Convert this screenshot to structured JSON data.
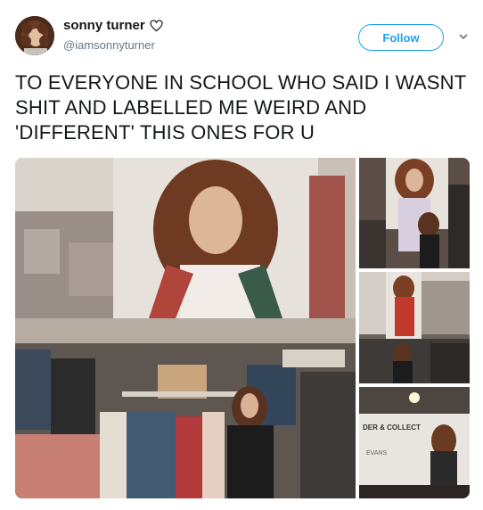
{
  "tweet": {
    "display_name": "sonny turner",
    "handle": "@iamsonnyturner",
    "follow_label": "Follow",
    "text": "TO EVERYONE IN SCHOOL WHO SAID I WASNT SHIT AND LABELLED ME WEIRD AND 'DIFFERENT' THIS ONES FOR U"
  },
  "media": {
    "sign_text": "DER & COLLECT",
    "brand_text": "EVANS"
  },
  "colors": {
    "accent": "#1da1f2",
    "text": "#14171a",
    "secondary": "#657786"
  },
  "icons": {
    "name_badge": "heart-outline-icon",
    "menu": "chevron-down-icon"
  }
}
